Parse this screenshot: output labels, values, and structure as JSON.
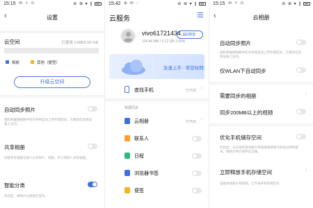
{
  "panel1": {
    "status": {
      "time": "15:15",
      "icons": "✉ ✧ ⊙",
      "right": "⊘ ⊛ ▾ ∥"
    },
    "title": "设置",
    "cloud_space_label": "云空间",
    "usage_text": "已使用 0 MB/5.00 GB",
    "usage_fraction": 0.0,
    "legend": [
      {
        "label": "相册",
        "color": "#3d6fe0"
      },
      {
        "label": "其他（便签）",
        "color": "#f5b321"
      }
    ],
    "upgrade_button": "升级云空间",
    "items": [
      {
        "label": "自动同步照片",
        "desc": "相机和截图相册中的文件将自动上传存储空间，方便您在其他设备上访问。",
        "on": false
      },
      {
        "label": "共享相册",
        "desc": "创建共享相册与他人分享照片、视频，并订阅他人共享相册。",
        "on": false
      },
      {
        "label": "智能分类",
        "desc": "开启后，将照片分类进行显示。",
        "on": true
      }
    ]
  },
  "panel2": {
    "status": {
      "time": "15:42",
      "icons": "⊕ ✉ ◌",
      "right": "⊘ ⊛ ▾ ∥"
    },
    "title": "云服务",
    "account": {
      "name": "vivo61721434…",
      "quota": "124.46 MB / 5.12 GB 2.43%",
      "button": "空间管理 ›"
    },
    "banner_text": "急速上手 · 带您玩转云服务",
    "find_phone": {
      "label": "查找手机",
      "status": "已开启"
    },
    "sync_header": "数据同步",
    "sync_items": [
      {
        "label": "云相册",
        "status": "已开启",
        "icon": "album-icon",
        "color": "#3d6fe0"
      },
      {
        "label": "联系人",
        "status": "",
        "icon": "contacts-icon",
        "color": "#ff9f2e"
      },
      {
        "label": "日程",
        "status": "",
        "icon": "calendar-icon",
        "color": "#2db97a"
      },
      {
        "label": "浏览器书签",
        "status": "",
        "icon": "bookmark-icon",
        "color": "#3d6fe0"
      },
      {
        "label": "便签",
        "status": "",
        "icon": "notes-icon",
        "color": "#f5b321"
      }
    ]
  },
  "panel3": {
    "status": {
      "time": "15:15",
      "icons": "✉ ✧ ⊙",
      "right": "⊘ ⊛ ▾ ∥"
    },
    "title": "云相册",
    "items": [
      {
        "label": "自动同步照片",
        "desc": "相机和截图相册中的文件将自动上传存储空间，方便您在其他设备上访问。"
      },
      {
        "label": "仅WLAN下自动同步",
        "desc": ""
      },
      {
        "label": "需要同步的相册",
        "desc": ""
      },
      {
        "label": "同步200MB以上的视频",
        "desc": ""
      },
      {
        "label": "优化手机储存空间",
        "desc": "开启后，30天前的本地照片和视频将替换为较低分辨率版本，原始文件仍保存在云端。"
      },
      {
        "label": "立即释放手机存储空间",
        "desc": "压缩本地照片和视频，以节省手机存储空间"
      }
    ]
  }
}
